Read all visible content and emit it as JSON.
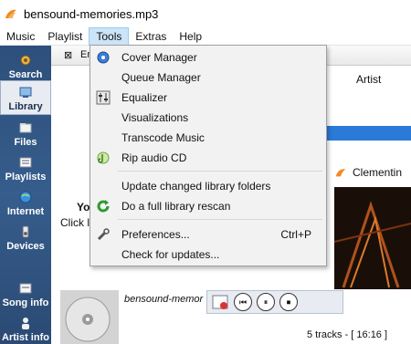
{
  "window": {
    "title": "bensound-memories.mp3"
  },
  "menubar": {
    "items": [
      "Music",
      "Playlist",
      "Tools",
      "Extras",
      "Help"
    ]
  },
  "sidebar": {
    "items": [
      "Search",
      "Library",
      "Files",
      "Playlists",
      "Internet",
      "Devices",
      "Song info",
      "Artist info"
    ]
  },
  "content": {
    "toolbar_text": "Er",
    "artist_header": "Artist",
    "now_playing": "Clementin",
    "hint_title": "Yo",
    "hint_text": "Click l"
  },
  "tools_menu": {
    "items": [
      {
        "label": "Cover Manager",
        "icon": "cover-manager-icon",
        "shortcut": ""
      },
      {
        "label": "Queue Manager",
        "icon": "",
        "shortcut": ""
      },
      {
        "label": "Equalizer",
        "icon": "equalizer-icon",
        "shortcut": ""
      },
      {
        "label": "Visualizations",
        "icon": "",
        "shortcut": ""
      },
      {
        "label": "Transcode Music",
        "icon": "",
        "shortcut": ""
      },
      {
        "label": "Rip audio CD",
        "icon": "rip-cd-icon",
        "shortcut": ""
      },
      {
        "label": "Update changed library folders",
        "icon": "",
        "shortcut": ""
      },
      {
        "label": "Do a full library rescan",
        "icon": "rescan-icon",
        "shortcut": ""
      },
      {
        "label": "Preferences...",
        "icon": "preferences-icon",
        "shortcut": "Ctrl+P"
      },
      {
        "label": "Check for updates...",
        "icon": "",
        "shortcut": ""
      }
    ]
  },
  "player": {
    "track_name": "bensound-memor",
    "status": "5 tracks - [ 16:16 ]"
  }
}
